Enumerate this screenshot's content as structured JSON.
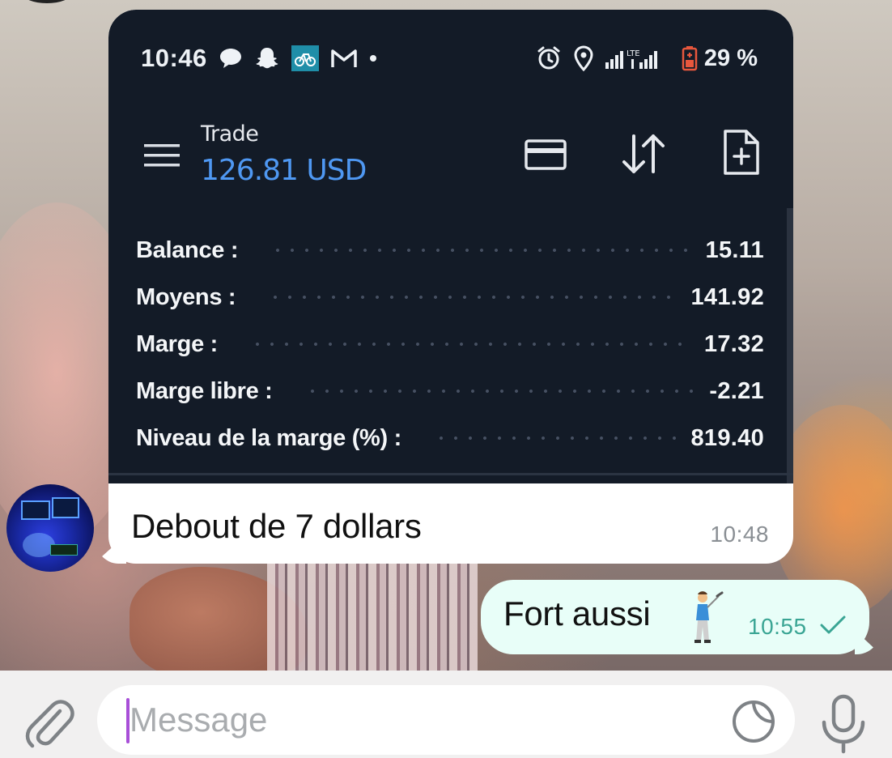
{
  "status_bar": {
    "time": "10:46",
    "left_icons": [
      "chat-bubble-icon",
      "snapchat-ghost-icon",
      "bike-app-icon",
      "gmail-icon",
      "notification-dot-icon"
    ],
    "right_icons": [
      "alarm-icon",
      "location-pin-icon",
      "signal-lte-icon",
      "battery-low-icon"
    ],
    "battery": "29 %"
  },
  "trade": {
    "title": "Trade",
    "amount": "126.81 USD",
    "actions": [
      "card-icon",
      "transfer-arrows-icon",
      "new-document-icon"
    ]
  },
  "account": [
    {
      "label": "Balance :",
      "value": "15.11"
    },
    {
      "label": "Moyens :",
      "value": "141.92"
    },
    {
      "label": "Marge :",
      "value": "17.32"
    },
    {
      "label": "Marge libre :",
      "value": "-2.21"
    },
    {
      "label": "Niveau de la marge (%) :",
      "value": "819.40"
    }
  ],
  "incoming_message": {
    "text": "Debout de 7 dollars",
    "time": "10:48"
  },
  "outgoing_message": {
    "text": "Fort aussi",
    "emoji": "golfer-emoji",
    "time": "10:55",
    "status": "sent-check-icon"
  },
  "composer": {
    "placeholder": "Message"
  },
  "colors": {
    "trade_panel_bg": "#131b27",
    "trade_amount_blue": "#4f98f2",
    "outgoing_bubble": "#e8fef8",
    "outgoing_time": "#3aa594",
    "cursor": "#a84fd8"
  }
}
